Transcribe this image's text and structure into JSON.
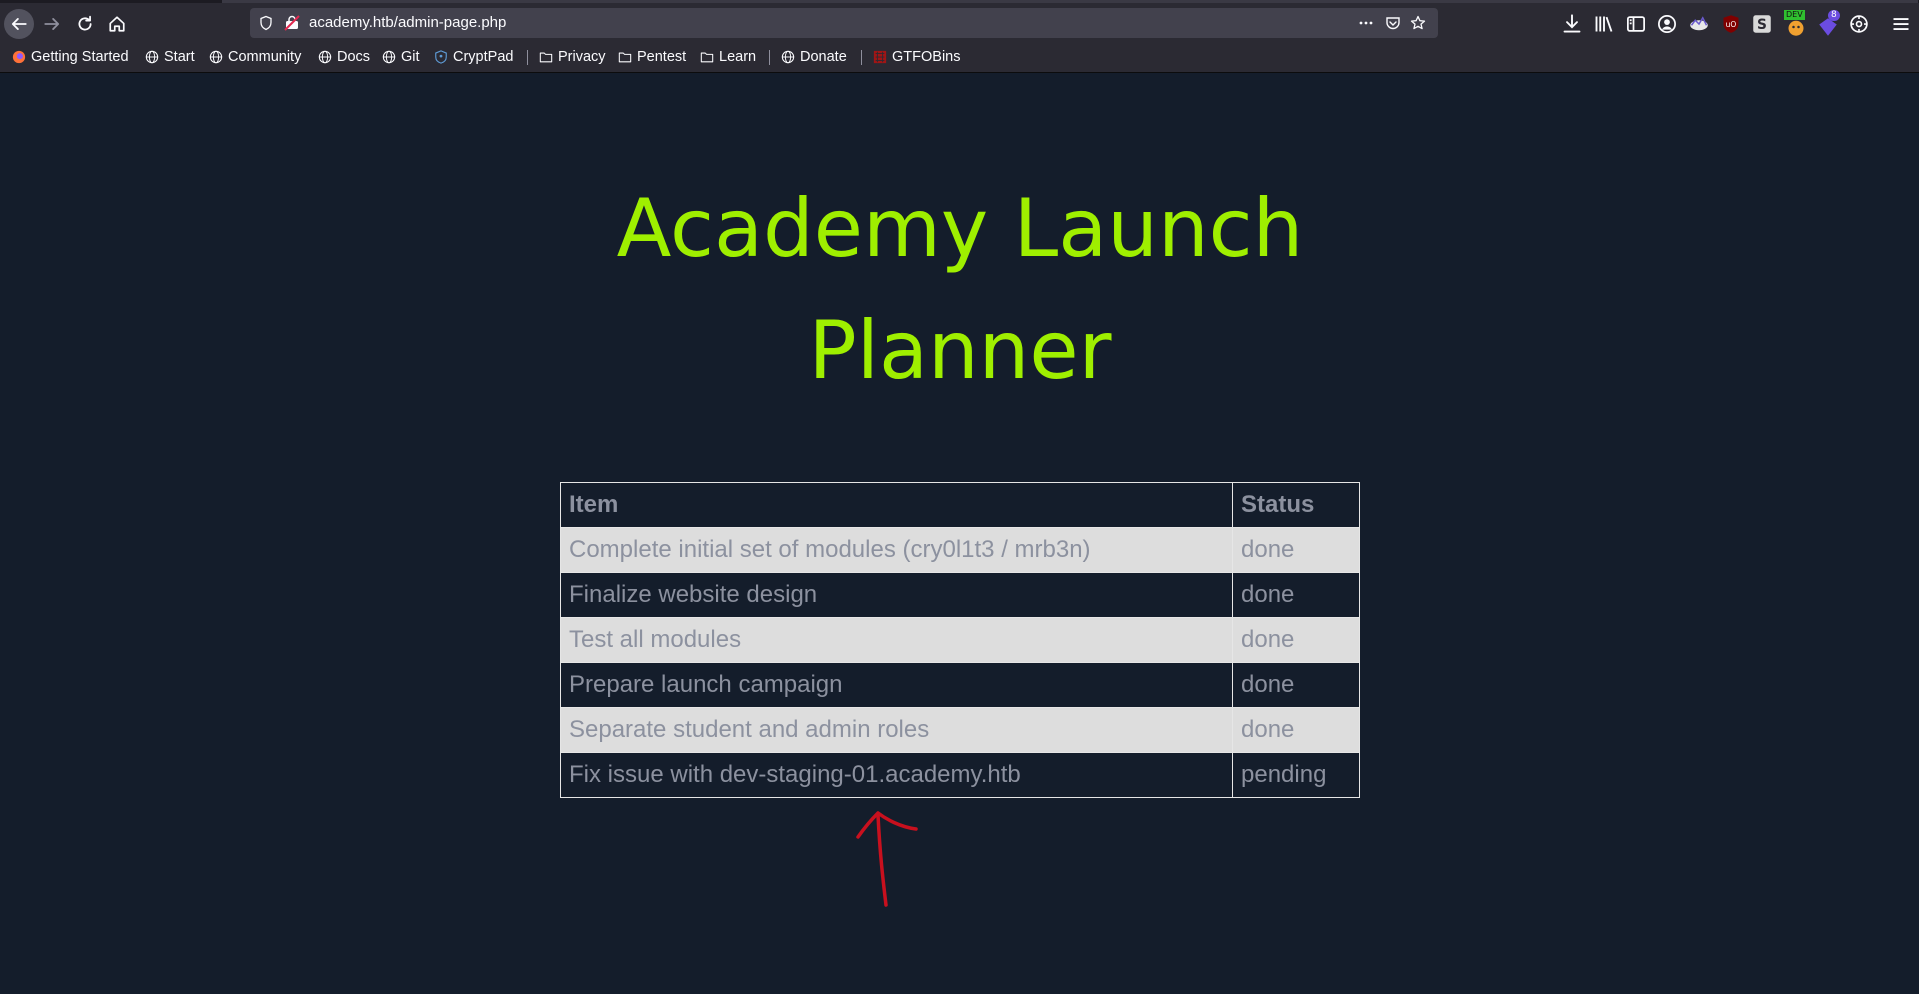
{
  "browser": {
    "url": "academy.htb/admin-page.php",
    "nav_icons": [
      "back-arrow-icon",
      "forward-arrow-icon",
      "reload-icon",
      "home-icon"
    ],
    "url_icons": [
      "shield-icon",
      "site-identity-icon",
      "more-dots-icon",
      "pocket-icon",
      "bookmark-star-icon"
    ],
    "toolbar_icons": [
      "download-icon",
      "library-icon",
      "sidebar-icon",
      "account-icon",
      "extension-icon",
      "ublock-icon",
      "extension-s-icon",
      "extension-dev-icon",
      "extension-badge-icon",
      "settings-icon",
      "menu-icon"
    ],
    "extension_badge": "8",
    "extension_dev_label": "DEV"
  },
  "bookmarks": {
    "items": [
      {
        "label": "Getting Started",
        "icon": "firefox-icon"
      },
      {
        "label": "Start",
        "icon": "globe-icon"
      },
      {
        "label": "Community",
        "icon": "globe-icon"
      },
      {
        "label": "Docs",
        "icon": "globe-icon"
      },
      {
        "label": "Git",
        "icon": "globe-icon"
      },
      {
        "label": "CryptPad",
        "icon": "cryptpad-icon"
      },
      {
        "label": "Privacy",
        "icon": "folder-icon"
      },
      {
        "label": "Pentest",
        "icon": "folder-icon"
      },
      {
        "label": "Learn",
        "icon": "folder-icon"
      },
      {
        "label": "Donate",
        "icon": "globe-icon"
      },
      {
        "label": "GTFOBins",
        "icon": "gtfobins-icon"
      }
    ]
  },
  "page": {
    "title": "Academy Launch Planner",
    "table": {
      "headers": [
        "Item",
        "Status"
      ],
      "rows": [
        {
          "item": "Complete initial set of modules (cry0l1t3 / mrb3n)",
          "status": "done"
        },
        {
          "item": "Finalize website design",
          "status": "done"
        },
        {
          "item": "Test all modules",
          "status": "done"
        },
        {
          "item": "Prepare launch campaign",
          "status": "done"
        },
        {
          "item": "Separate student and admin roles",
          "status": "done"
        },
        {
          "item": "Fix issue with dev-staging-01.academy.htb",
          "status": "pending"
        }
      ]
    }
  },
  "colors": {
    "background": "#141d2b",
    "title": "#9fef00",
    "table_text": "#8c919f",
    "light_row": "#dddddd",
    "annotation": "#c8101e"
  }
}
